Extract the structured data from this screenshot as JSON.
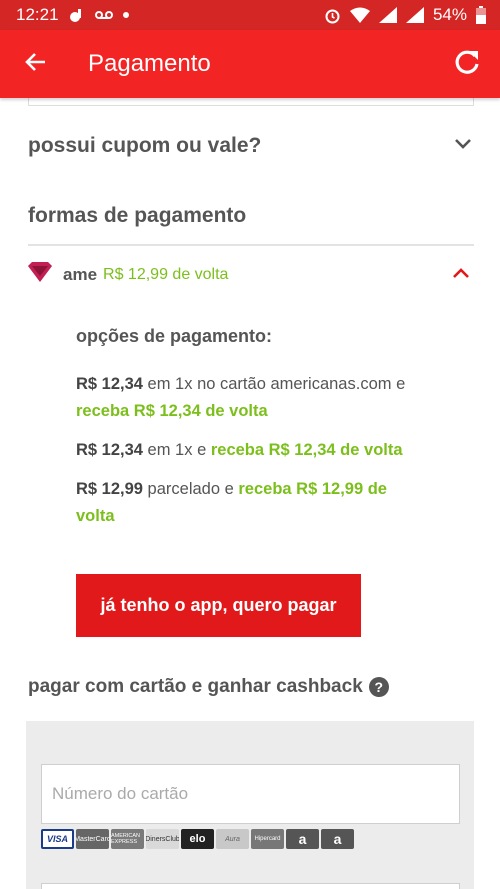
{
  "status_bar": {
    "time": "12:21",
    "battery": "54%"
  },
  "app_bar": {
    "title": "Pagamento",
    "back_icon": "arrow-left-icon",
    "refresh_icon": "refresh-icon"
  },
  "coupon": {
    "label": "possui cupom ou vale?"
  },
  "payment_methods": {
    "title": "formas de pagamento",
    "ame": {
      "brand": "ame",
      "cashback": "R$ 12,99 de volta"
    },
    "options": {
      "title": "opções de pagamento:",
      "items": [
        {
          "price": "R$ 12,34",
          "text": " em 1x no cartão americanas.com e ",
          "highlight": "receba R$ 12,34 de volta"
        },
        {
          "price": "R$ 12,34",
          "text": " em 1x e ",
          "highlight": "receba R$ 12,34 de volta"
        },
        {
          "price": "R$ 12,99",
          "text": " parcelado e ",
          "highlight": "receba R$ 12,99 de volta"
        }
      ]
    },
    "app_button": "já tenho o app, quero pagar"
  },
  "card_cashback": {
    "title": "pagar com cartão e ganhar cashback",
    "help": "?",
    "card_number_placeholder": "Número do cartão",
    "card_brands": [
      "VISA",
      "MasterCard",
      "AMERICAN EXPRESS",
      "DinersClub",
      "elo",
      "Aura",
      "Hipercard",
      "a",
      "a"
    ]
  },
  "colors": {
    "status_bar": "#d42624",
    "app_bar": "#f22424",
    "button": "#e1191b",
    "green": "#7cbf1c"
  }
}
